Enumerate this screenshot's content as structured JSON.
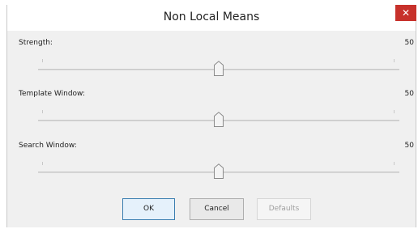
{
  "window": {
    "title": "Non Local Means",
    "close_label": "✕"
  },
  "sliders": [
    {
      "label": "Strength:",
      "value": "50",
      "level_percent": 50
    },
    {
      "label": "Template Window:",
      "value": "50",
      "level_percent": 50
    },
    {
      "label": "Search Window:",
      "value": "50",
      "level_percent": 50
    }
  ],
  "buttons": {
    "ok": "OK",
    "cancel": "Cancel",
    "defaults": "Defaults"
  },
  "colors": {
    "close_button": "#c7312b",
    "client_background": "#f0f0f0",
    "ok_border": "#3c7fb1"
  }
}
